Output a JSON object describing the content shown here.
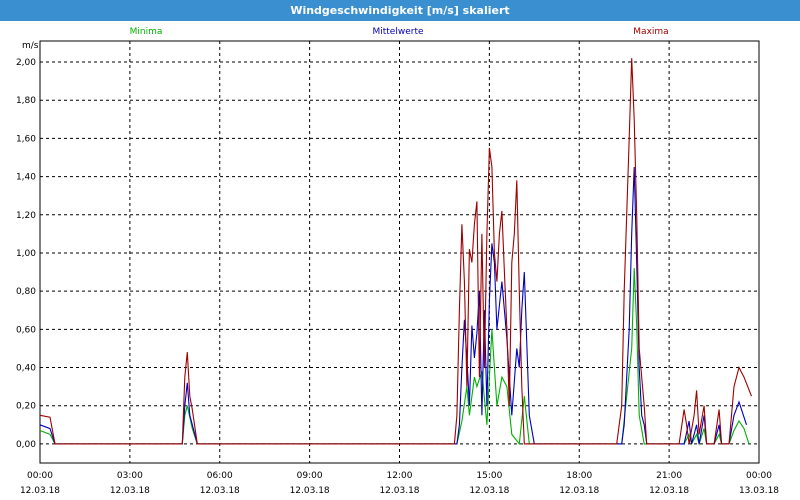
{
  "window": {
    "title": "Windgeschwindigkeit [m/s] skaliert"
  },
  "colors": {
    "min": "#00b000",
    "mean": "#0000c0",
    "max": "#a00000",
    "titlebar": "#3a8fd0",
    "grid": "#000000"
  },
  "chart_data": {
    "type": "line",
    "title": "Windgeschwindigkeit [m/s] skaliert",
    "ylabel": "m/s",
    "xlabel": "",
    "ylim": [
      -0.1,
      2.11
    ],
    "xlim": [
      "12.03.18 00:00",
      "13.03.18 00:00"
    ],
    "grid": true,
    "legend": "top (inline above plot)",
    "yticks": [
      "0,00",
      "0,20",
      "0,40",
      "0,60",
      "0,80",
      "1,00",
      "1,20",
      "1,40",
      "1,60",
      "1,80",
      "2,00"
    ],
    "ytick_values": [
      0,
      0.2,
      0.4,
      0.6,
      0.8,
      1.0,
      1.2,
      1.4,
      1.6,
      1.8,
      2.0
    ],
    "xticks": [
      {
        "time": "00:00",
        "date": "12.03.18"
      },
      {
        "time": "03:00",
        "date": "12.03.18"
      },
      {
        "time": "06:00",
        "date": "12.03.18"
      },
      {
        "time": "09:00",
        "date": "12.03.18"
      },
      {
        "time": "12:00",
        "date": "12.03.18"
      },
      {
        "time": "15:00",
        "date": "12.03.18"
      },
      {
        "time": "18:00",
        "date": "12.03.18"
      },
      {
        "time": "21:00",
        "date": "12.03.18"
      },
      {
        "time": "00:00",
        "date": "13.03.18"
      }
    ],
    "series": [
      {
        "name": "Minima",
        "color": "#00b000",
        "points": [
          [
            "00:00",
            0.07
          ],
          [
            "00:20",
            0.05
          ],
          [
            "00:30",
            0.0
          ],
          [
            "04:45",
            0.0
          ],
          [
            "04:50",
            0.15
          ],
          [
            "04:55",
            0.2
          ],
          [
            "05:05",
            0.08
          ],
          [
            "05:15",
            0.0
          ],
          [
            "13:55",
            0.0
          ],
          [
            "14:05",
            0.12
          ],
          [
            "14:15",
            0.3
          ],
          [
            "14:20",
            0.15
          ],
          [
            "14:30",
            0.35
          ],
          [
            "14:35",
            0.3
          ],
          [
            "14:45",
            0.38
          ],
          [
            "14:55",
            0.1
          ],
          [
            "15:05",
            0.6
          ],
          [
            "15:15",
            0.2
          ],
          [
            "15:25",
            0.35
          ],
          [
            "15:35",
            0.3
          ],
          [
            "15:45",
            0.05
          ],
          [
            "16:00",
            0.0
          ],
          [
            "16:10",
            0.25
          ],
          [
            "16:20",
            0.0
          ],
          [
            "16:45",
            0.0
          ],
          [
            "19:25",
            0.0
          ],
          [
            "19:35",
            0.25
          ],
          [
            "19:45",
            0.5
          ],
          [
            "19:50",
            0.92
          ],
          [
            "19:55",
            0.62
          ],
          [
            "20:00",
            0.15
          ],
          [
            "20:10",
            0.0
          ],
          [
            "20:25",
            0.0
          ],
          [
            "21:30",
            0.0
          ],
          [
            "21:40",
            0.05
          ],
          [
            "21:45",
            0.0
          ],
          [
            "21:55",
            0.05
          ],
          [
            "22:00",
            0.0
          ],
          [
            "22:10",
            0.08
          ],
          [
            "22:15",
            0.0
          ],
          [
            "22:30",
            0.0
          ],
          [
            "22:40",
            0.05
          ],
          [
            "22:45",
            0.0
          ],
          [
            "23:00",
            0.0
          ],
          [
            "23:10",
            0.07
          ],
          [
            "23:20",
            0.12
          ],
          [
            "23:30",
            0.08
          ],
          [
            "23:40",
            0.0
          ]
        ]
      },
      {
        "name": "Mittelwerte",
        "color": "#0000c0",
        "points": [
          [
            "00:00",
            0.1
          ],
          [
            "00:20",
            0.08
          ],
          [
            "00:30",
            0.0
          ],
          [
            "04:45",
            0.0
          ],
          [
            "04:50",
            0.2
          ],
          [
            "04:55",
            0.32
          ],
          [
            "05:00",
            0.15
          ],
          [
            "05:05",
            0.1
          ],
          [
            "05:15",
            0.0
          ],
          [
            "13:55",
            0.0
          ],
          [
            "14:00",
            0.1
          ],
          [
            "14:05",
            0.4
          ],
          [
            "14:10",
            0.65
          ],
          [
            "14:15",
            0.45
          ],
          [
            "14:20",
            0.2
          ],
          [
            "14:25",
            0.62
          ],
          [
            "14:30",
            0.45
          ],
          [
            "14:35",
            0.58
          ],
          [
            "14:40",
            0.8
          ],
          [
            "14:45",
            0.15
          ],
          [
            "14:50",
            0.7
          ],
          [
            "14:55",
            0.2
          ],
          [
            "15:00",
            0.75
          ],
          [
            "15:05",
            1.05
          ],
          [
            "15:10",
            0.95
          ],
          [
            "15:15",
            0.6
          ],
          [
            "15:25",
            0.85
          ],
          [
            "15:35",
            0.55
          ],
          [
            "15:45",
            0.15
          ],
          [
            "15:55",
            0.5
          ],
          [
            "16:00",
            0.4
          ],
          [
            "16:05",
            0.7
          ],
          [
            "16:10",
            0.9
          ],
          [
            "16:20",
            0.15
          ],
          [
            "16:30",
            0.0
          ],
          [
            "16:45",
            0.0
          ],
          [
            "19:25",
            0.0
          ],
          [
            "19:30",
            0.1
          ],
          [
            "19:40",
            0.6
          ],
          [
            "19:45",
            1.1
          ],
          [
            "19:50",
            1.45
          ],
          [
            "19:55",
            0.95
          ],
          [
            "20:00",
            0.4
          ],
          [
            "20:05",
            0.15
          ],
          [
            "20:10",
            0.1
          ],
          [
            "20:15",
            0.0
          ],
          [
            "20:25",
            0.0
          ],
          [
            "21:30",
            0.0
          ],
          [
            "21:40",
            0.12
          ],
          [
            "21:45",
            0.0
          ],
          [
            "21:55",
            0.1
          ],
          [
            "22:00",
            0.0
          ],
          [
            "22:10",
            0.15
          ],
          [
            "22:15",
            0.0
          ],
          [
            "22:30",
            0.0
          ],
          [
            "22:40",
            0.1
          ],
          [
            "22:45",
            0.0
          ],
          [
            "23:00",
            0.0
          ],
          [
            "23:10",
            0.15
          ],
          [
            "23:20",
            0.22
          ],
          [
            "23:35",
            0.1
          ]
        ]
      },
      {
        "name": "Maxima",
        "color": "#a00000",
        "points": [
          [
            "00:00",
            0.15
          ],
          [
            "00:20",
            0.14
          ],
          [
            "00:30",
            0.0
          ],
          [
            "04:45",
            0.0
          ],
          [
            "04:50",
            0.35
          ],
          [
            "04:55",
            0.48
          ],
          [
            "05:00",
            0.25
          ],
          [
            "05:05",
            0.18
          ],
          [
            "05:15",
            0.0
          ],
          [
            "13:50",
            0.0
          ],
          [
            "13:55",
            0.15
          ],
          [
            "14:00",
            0.7
          ],
          [
            "14:05",
            1.15
          ],
          [
            "14:10",
            0.85
          ],
          [
            "14:15",
            0.3
          ],
          [
            "14:20",
            1.02
          ],
          [
            "14:25",
            0.95
          ],
          [
            "14:30",
            1.15
          ],
          [
            "14:35",
            1.27
          ],
          [
            "14:40",
            0.35
          ],
          [
            "14:45",
            1.1
          ],
          [
            "14:50",
            0.4
          ],
          [
            "14:55",
            1.1
          ],
          [
            "15:00",
            1.55
          ],
          [
            "15:05",
            1.45
          ],
          [
            "15:10",
            1.0
          ],
          [
            "15:15",
            0.85
          ],
          [
            "15:20",
            1.1
          ],
          [
            "15:25",
            1.22
          ],
          [
            "15:30",
            0.9
          ],
          [
            "15:35",
            0.6
          ],
          [
            "15:40",
            0.2
          ],
          [
            "15:45",
            0.95
          ],
          [
            "15:50",
            1.1
          ],
          [
            "15:55",
            1.38
          ],
          [
            "16:00",
            0.8
          ],
          [
            "16:05",
            0.3
          ],
          [
            "16:10",
            0.0
          ],
          [
            "16:45",
            0.0
          ],
          [
            "19:15",
            0.0
          ],
          [
            "19:25",
            0.2
          ],
          [
            "19:30",
            0.8
          ],
          [
            "19:35",
            1.2
          ],
          [
            "19:40",
            1.6
          ],
          [
            "19:45",
            2.02
          ],
          [
            "19:50",
            1.7
          ],
          [
            "19:55",
            1.2
          ],
          [
            "20:00",
            0.5
          ],
          [
            "20:05",
            0.35
          ],
          [
            "20:10",
            0.2
          ],
          [
            "20:15",
            0.0
          ],
          [
            "20:25",
            0.0
          ],
          [
            "21:20",
            0.0
          ],
          [
            "21:30",
            0.18
          ],
          [
            "21:35",
            0.1
          ],
          [
            "21:40",
            0.0
          ],
          [
            "21:50",
            0.15
          ],
          [
            "21:55",
            0.28
          ],
          [
            "22:00",
            0.05
          ],
          [
            "22:10",
            0.2
          ],
          [
            "22:15",
            0.0
          ],
          [
            "22:30",
            0.0
          ],
          [
            "22:40",
            0.18
          ],
          [
            "22:45",
            0.0
          ],
          [
            "23:00",
            0.0
          ],
          [
            "23:05",
            0.15
          ],
          [
            "23:10",
            0.3
          ],
          [
            "23:20",
            0.4
          ],
          [
            "23:30",
            0.35
          ],
          [
            "23:45",
            0.25
          ]
        ]
      }
    ]
  }
}
